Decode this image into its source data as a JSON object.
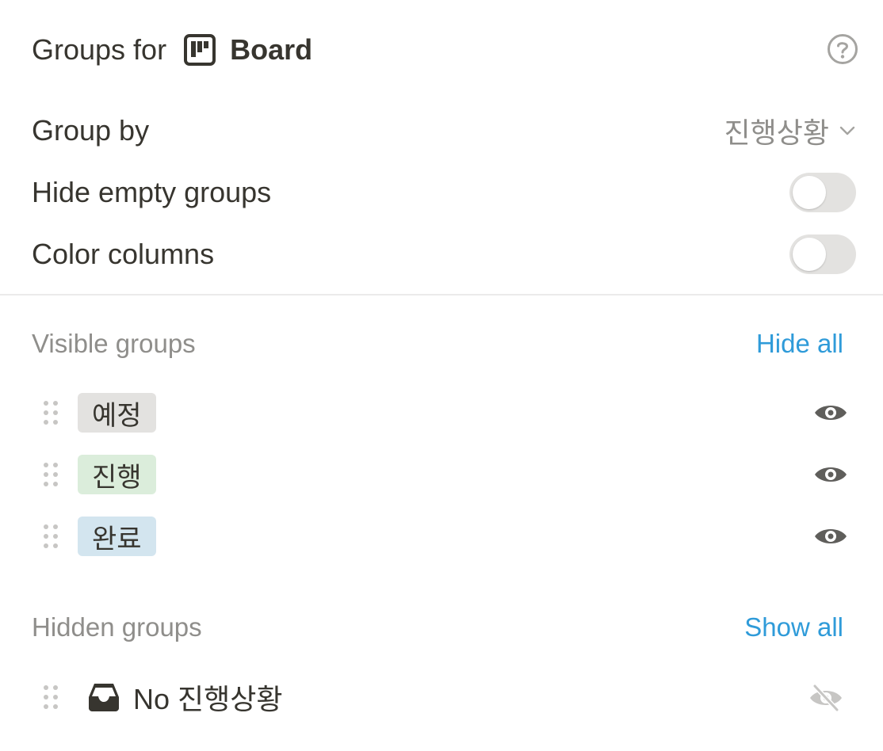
{
  "header": {
    "prefix": "Groups for",
    "view_icon": "board-icon",
    "view_name": "Board",
    "help_icon": "help-circle-icon"
  },
  "settings": {
    "group_by": {
      "label": "Group by",
      "value": "진행상황"
    },
    "hide_empty": {
      "label": "Hide empty groups",
      "on": false
    },
    "color_columns": {
      "label": "Color columns",
      "on": false
    }
  },
  "visible_groups": {
    "label": "Visible groups",
    "action": "Hide all",
    "items": [
      {
        "name": "예정",
        "color": "#e3e2e0"
      },
      {
        "name": "진행",
        "color": "#dbeddb"
      },
      {
        "name": "완료",
        "color": "#d3e5ef"
      }
    ]
  },
  "hidden_groups": {
    "label": "Hidden groups",
    "action": "Show all",
    "items": [
      {
        "name": "No 진행상황",
        "icon": "inbox-icon"
      }
    ]
  },
  "colors": {
    "accent": "#2f9bd9",
    "text": "#37352f",
    "muted": "#8f8e8b",
    "toggle_off": "#e3e2e0"
  }
}
